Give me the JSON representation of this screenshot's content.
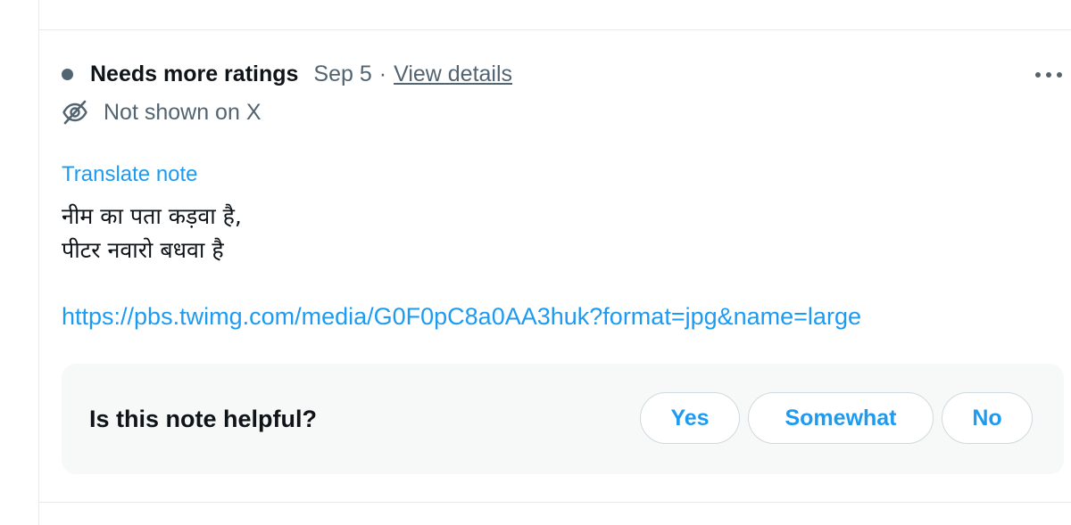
{
  "note": {
    "status_label": "Needs more ratings",
    "date": "Sep 5",
    "separator": "·",
    "view_details_label": "View details",
    "visibility_text": "Not shown on X",
    "translate_label": "Translate note",
    "body_lines": [
      "नीम का पता कड़वा है,",
      "पीटर नवारो बधवा है"
    ],
    "url": "https://pbs.twimg.com/media/G0F0pC8a0AA3huk?format=jpg&name=large"
  },
  "helpful": {
    "question": "Is this note helpful?",
    "yes_label": "Yes",
    "somewhat_label": "Somewhat",
    "no_label": "No"
  },
  "icons": {
    "more": "more-horizontal-icon",
    "visibility": "eye-slash-icon",
    "status_dot": "status-dot-icon"
  },
  "colors": {
    "link": "#1d9bf0",
    "secondary_text": "#536471",
    "primary_text": "#0f1419",
    "panel_bg": "#f7f9f9",
    "border": "#cfd9de"
  }
}
